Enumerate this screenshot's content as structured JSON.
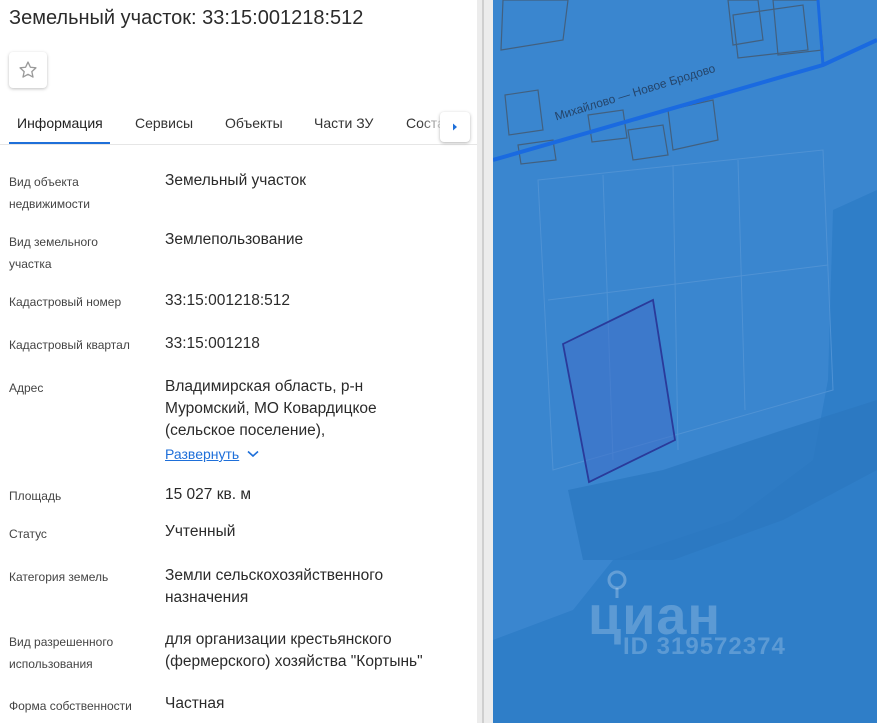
{
  "header": {
    "title": "Земельный участок: 33:15:001218:512"
  },
  "tabs": [
    {
      "label": "Информация",
      "active": true
    },
    {
      "label": "Сервисы"
    },
    {
      "label": "Объекты"
    },
    {
      "label": "Части ЗУ"
    },
    {
      "label": "Состав ЕЗП"
    }
  ],
  "info": {
    "object_type": {
      "label_line1": "Вид объекта",
      "label_line2": "недвижимости",
      "value": "Земельный участок"
    },
    "land_type": {
      "label_line1": "Вид земельного",
      "label_line2": "участка",
      "value": "Землепользование"
    },
    "cadastral_number": {
      "label": "Кадастровый номер",
      "value": "33:15:001218:512"
    },
    "cadastral_quarter": {
      "label": "Кадастровый квартал",
      "value": "33:15:001218"
    },
    "address": {
      "label": "Адрес",
      "line1": "Владимирская область, р-н",
      "line2": "Муромский, МО Ковардицкое",
      "line3": "(сельское поселение),",
      "expand_label": "Развернуть"
    },
    "area": {
      "label": "Площадь",
      "value": "15 027 кв. м"
    },
    "status": {
      "label": "Статус",
      "value": "Учтенный"
    },
    "land_category": {
      "label": "Категория земель",
      "line1": "Земли сельскохозяйственного",
      "line2": "назначения"
    },
    "permitted_use": {
      "label_line1": "Вид разрешенного",
      "label_line2": "использования",
      "line1": "для организации крестьянского",
      "line2": "(фермерского) хозяйства \"Кортынь\""
    },
    "ownership": {
      "label": "Форма собственности",
      "value": "Частная"
    }
  },
  "map": {
    "street_label": "Михайлово — Новое Бродово",
    "watermark_logo": "циан",
    "watermark_id": "ID 319572374"
  },
  "icons": {
    "favorite": "star-outline-icon",
    "next": "chevron-right-icon",
    "expand": "chevron-down-icon"
  },
  "colors": {
    "accent": "#1e6fd9",
    "map_fill": "#3a86cf",
    "parcel_stroke": "#2a3a9a"
  }
}
